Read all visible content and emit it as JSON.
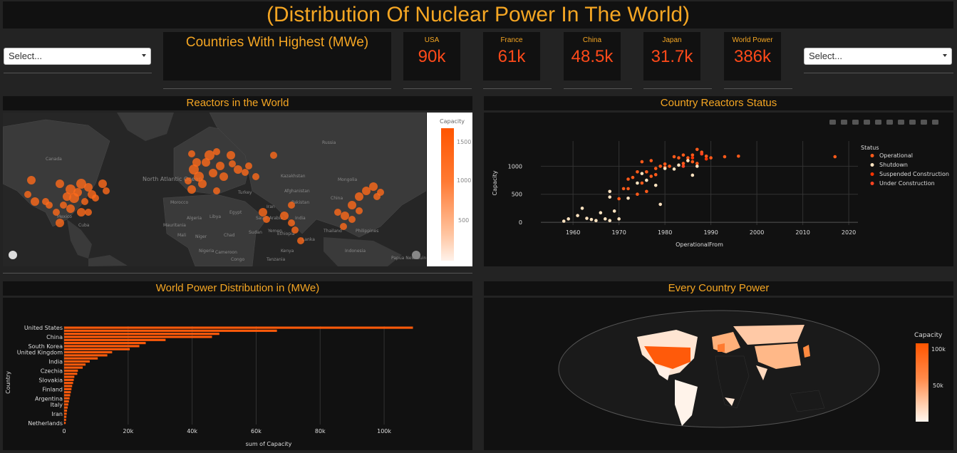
{
  "header": {
    "title": "(Distribution Of Nuclear Power In The World)"
  },
  "left_select": {
    "placeholder": "Select..."
  },
  "right_select": {
    "placeholder": "Select..."
  },
  "highest_title": "Countries With Highest (MWe)",
  "kpis": [
    {
      "label": "USA",
      "value": "90k"
    },
    {
      "label": "France",
      "value": "61k"
    },
    {
      "label": "China",
      "value": "48.5k"
    },
    {
      "label": "Japan",
      "value": "31.7k"
    },
    {
      "label": "World Power",
      "value": "386k"
    }
  ],
  "reactors_map": {
    "title": "Reactors in the World",
    "legend_title": "Capacity",
    "legend_ticks": [
      "1500",
      "1000",
      "500"
    ],
    "place_labels": [
      "Canada",
      "North Atlantic Ocean",
      "Russia",
      "Kazakhstan",
      "Mongolia",
      "China",
      "Turkey",
      "Iran",
      "Egypt",
      "Algeria",
      "Libya",
      "Niger",
      "Chad",
      "Sudan",
      "Ethiopia",
      "Cameroon",
      "Congo",
      "Tanzania",
      "Nigeria",
      "Mali",
      "Mauritania",
      "Saudi Arabia",
      "Pakistan",
      "India",
      "Thailand",
      "Philippines",
      "Indonesia",
      "Papua New Guinea",
      "Mexico",
      "Cuba",
      "Afghanistan",
      "Lanka",
      "Yemen",
      "Morocco",
      "Kenya"
    ],
    "colors": {
      "land": "#3a3a3a",
      "water": "#262626",
      "marker": "#ff6a1a"
    }
  },
  "status_chart": {
    "title": "Country Reactors Status",
    "xlabel": "OperationalFrom",
    "ylabel": "Capacity",
    "legend_title": "Status",
    "legend": [
      {
        "name": "Operational",
        "color": "#ff5a1a"
      },
      {
        "name": "Shutdown",
        "color": "#ffe3c0"
      },
      {
        "name": "Suspended Construction",
        "color": "#ff3300"
      },
      {
        "name": "Under Construction",
        "color": "#ff4422"
      }
    ],
    "modebar_icons": [
      "camera-icon",
      "zoom-icon",
      "pan-icon",
      "box-select-icon",
      "lasso-icon",
      "zoom-in-icon",
      "zoom-out-icon",
      "autoscale-icon",
      "home-icon",
      "plotly-logo-icon"
    ]
  },
  "power_chart": {
    "title": "World Power Distribution in (MWe)",
    "xlabel": "sum of Capacity",
    "ylabel": "Country"
  },
  "country_power": {
    "title": "Every Country Power",
    "legend_title": "Capacity",
    "legend_ticks": [
      "100k",
      "50k"
    ]
  },
  "chart_data": [
    {
      "type": "scatter",
      "title": "Country Reactors Status",
      "xlabel": "OperationalFrom",
      "ylabel": "Capacity",
      "xlim": [
        1953,
        2022
      ],
      "ylim": [
        -50,
        1450
      ],
      "xticks": [
        "1960",
        "1970",
        "1980",
        "1990",
        "2000",
        "2010",
        "2020"
      ],
      "yticks": [
        "0",
        "500",
        "1000"
      ],
      "series": [
        {
          "name": "Operational",
          "points": [
            [
              1970,
              420
            ],
            [
              1971,
              600
            ],
            [
              1972,
              770
            ],
            [
              1973,
              800
            ],
            [
              1974,
              900
            ],
            [
              1975,
              1080
            ],
            [
              1976,
              900
            ],
            [
              1977,
              1100
            ],
            [
              1978,
              850
            ],
            [
              1979,
              1000
            ],
            [
              1980,
              1040
            ],
            [
              1981,
              1000
            ],
            [
              1982,
              1170
            ],
            [
              1983,
              1150
            ],
            [
              1984,
              1200
            ],
            [
              1985,
              1150
            ],
            [
              1986,
              1200
            ],
            [
              1987,
              1300
            ],
            [
              1988,
              1250
            ],
            [
              1989,
              1180
            ],
            [
              1990,
              1150
            ],
            [
              1993,
              1170
            ],
            [
              1996,
              1180
            ],
            [
              2017,
              1170
            ],
            [
              1976,
              550
            ],
            [
              1974,
              500
            ],
            [
              1972,
              600
            ],
            [
              1978,
              960
            ],
            [
              1985,
              1100
            ],
            [
              1987,
              1050
            ],
            [
              1984,
              1050
            ],
            [
              1975,
              700
            ],
            [
              1977,
              820
            ],
            [
              1980,
              980
            ],
            [
              1986,
              1080
            ]
          ]
        },
        {
          "name": "Shutdown",
          "points": [
            [
              1958,
              20
            ],
            [
              1959,
              60
            ],
            [
              1961,
              120
            ],
            [
              1962,
              250
            ],
            [
              1963,
              70
            ],
            [
              1964,
              50
            ],
            [
              1965,
              30
            ],
            [
              1966,
              170
            ],
            [
              1967,
              60
            ],
            [
              1968,
              30
            ],
            [
              1969,
              200
            ],
            [
              1968,
              450
            ],
            [
              1968,
              550
            ],
            [
              1970,
              60
            ],
            [
              1972,
              430
            ],
            [
              1974,
              700
            ],
            [
              1976,
              750
            ],
            [
              1978,
              660
            ],
            [
              1980,
              960
            ],
            [
              1983,
              1020
            ],
            [
              1985,
              1100
            ],
            [
              1987,
              1000
            ],
            [
              1979,
              320
            ],
            [
              1975,
              870
            ],
            [
              1982,
              950
            ],
            [
              1986,
              840
            ]
          ]
        },
        {
          "name": "Suspended Construction",
          "points": [
            [
              1986,
              1150
            ],
            [
              1989,
              1130
            ]
          ]
        },
        {
          "name": "Under Construction",
          "points": [
            [
              1988,
              1220
            ],
            [
              1984,
              1000
            ]
          ]
        }
      ]
    },
    {
      "type": "bar",
      "orientation": "horizontal",
      "title": "World Power Distribution in (MWe)",
      "xlabel": "sum of Capacity",
      "ylabel": "Country",
      "xlim": [
        0,
        110000
      ],
      "xticks": [
        "0",
        "20k",
        "40k",
        "60k",
        "80k",
        "100k"
      ],
      "categories": [
        "United States",
        "China",
        "South Korea",
        "United Kingdom",
        "India",
        "Czechia",
        "Slovakia",
        "Finland",
        "Argentina",
        "Italy",
        "Iran",
        "Netherlands"
      ],
      "all_values": [
        109000,
        66500,
        48500,
        46200,
        31700,
        25500,
        23500,
        20500,
        15000,
        13500,
        10500,
        8000,
        6700,
        5800,
        4300,
        4100,
        3200,
        3000,
        2800,
        2500,
        2300,
        2100,
        1900,
        1700,
        1500,
        1300,
        1100,
        915,
        800,
        700,
        600,
        480
      ]
    }
  ]
}
